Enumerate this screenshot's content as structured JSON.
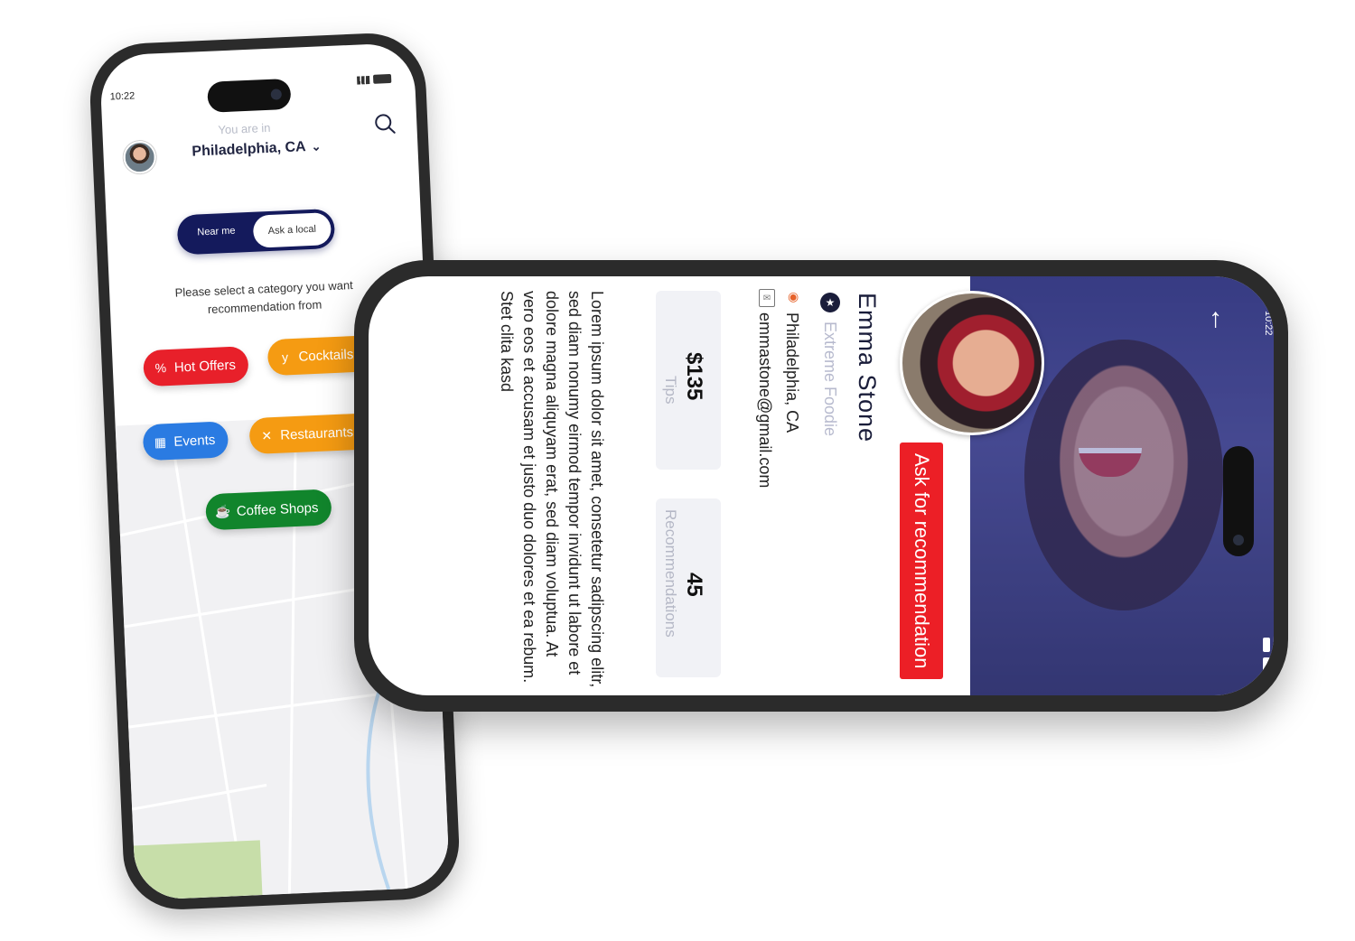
{
  "phone1": {
    "status": {
      "time": "10:22"
    },
    "header": {
      "location_prompt": "You are in",
      "city": "Philadelphia, CA"
    },
    "toggle": {
      "left_label": "Near me",
      "right_label": "Ask a local",
      "selected": "Ask a local"
    },
    "prompt": "Please select a category you want recommendation from",
    "categories": [
      {
        "label": "Hot Offers",
        "color": "#e8202a",
        "icon": "percent-badge-icon"
      },
      {
        "label": "Cocktails",
        "color": "#f59b12",
        "icon": "cocktail-icon"
      },
      {
        "label": "Events",
        "color": "#2a7be2",
        "icon": "calendar-icon"
      },
      {
        "label": "Restaurants",
        "color": "#f59b12",
        "icon": "fork-knife-icon"
      },
      {
        "label": "Coffee Shops",
        "color": "#11852c",
        "icon": "coffee-cup-icon"
      }
    ],
    "colors": {
      "toggle": "#141a5c"
    }
  },
  "phone2": {
    "status": {
      "time": "10:22"
    },
    "profile": {
      "name": "Emma Stone",
      "tier": "Extreme Foodie",
      "location": "Philadelphia, CA",
      "email": "emmastone@gmail.com"
    },
    "cta": {
      "label": "Ask for recommendation",
      "color": "#ec1f26"
    },
    "stats": [
      {
        "value": "$135",
        "label": "Tips"
      },
      {
        "value": "45",
        "label": "Recommendations"
      }
    ],
    "bio": "Lorem ipsum dolor sit amet, consetetur sadipscing elitr, sed diam nonumy eirmod tempor invidunt ut labore et dolore magna aliquyam erat, sed diam voluptua. At vero eos et accusam et justo duo dolores et ea rebum. Stet clita kasd"
  }
}
